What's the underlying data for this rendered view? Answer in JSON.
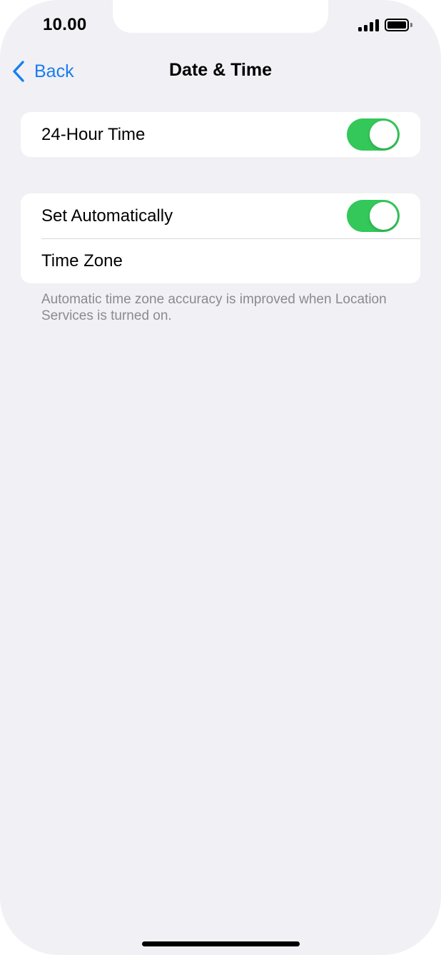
{
  "status_bar": {
    "time": "10.00",
    "signal_icon": "signal-bars-icon",
    "battery_icon": "battery-full-icon"
  },
  "nav": {
    "back_label": "Back",
    "back_icon": "chevron-left-icon",
    "title": "Date & Time"
  },
  "groups": [
    {
      "rows": [
        {
          "label": "24-Hour Time",
          "toggle_on": true
        }
      ]
    },
    {
      "rows": [
        {
          "label": "Set Automatically",
          "toggle_on": true
        },
        {
          "label": "Time Zone"
        }
      ],
      "footer": "Automatic time zone accuracy is improved when Location Services is turned on."
    }
  ],
  "colors": {
    "accent": "#1a7df0",
    "toggle_on": "#34c759",
    "background": "#f0f0f5"
  }
}
